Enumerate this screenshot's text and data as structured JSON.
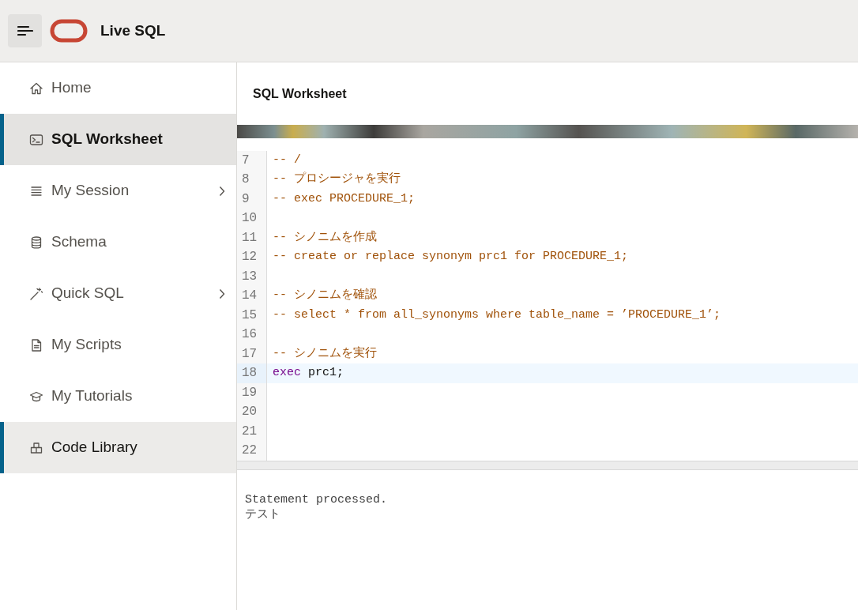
{
  "header": {
    "title": "Live SQL"
  },
  "sidebar": {
    "items": [
      {
        "label": "Home",
        "selected": false,
        "focused": false,
        "has_submenu": false
      },
      {
        "label": "SQL Worksheet",
        "selected": true,
        "focused": false,
        "has_submenu": false
      },
      {
        "label": "My Session",
        "selected": false,
        "focused": false,
        "has_submenu": true
      },
      {
        "label": "Schema",
        "selected": false,
        "focused": false,
        "has_submenu": false
      },
      {
        "label": "Quick SQL",
        "selected": false,
        "focused": false,
        "has_submenu": true
      },
      {
        "label": "My Scripts",
        "selected": false,
        "focused": false,
        "has_submenu": false
      },
      {
        "label": "My Tutorials",
        "selected": false,
        "focused": false,
        "has_submenu": false
      },
      {
        "label": "Code Library",
        "selected": false,
        "focused": true,
        "has_submenu": false
      }
    ]
  },
  "page": {
    "title": "SQL Worksheet"
  },
  "editor": {
    "lines": [
      {
        "number": "7",
        "active": false,
        "tokens": [
          {
            "kind": "comment",
            "text": "-- /"
          }
        ]
      },
      {
        "number": "8",
        "active": false,
        "tokens": [
          {
            "kind": "comment",
            "text": "-- プロシージャを実行"
          }
        ]
      },
      {
        "number": "9",
        "active": false,
        "tokens": [
          {
            "kind": "comment",
            "text": "-- exec PROCEDURE_1;"
          }
        ]
      },
      {
        "number": "10",
        "active": false
      },
      {
        "number": "11",
        "active": false,
        "tokens": [
          {
            "kind": "comment",
            "text": "-- シノニムを作成"
          }
        ]
      },
      {
        "number": "12",
        "active": false,
        "tokens": [
          {
            "kind": "comment",
            "text": "-- create or replace synonym prc1 for PROCEDURE_1;"
          }
        ]
      },
      {
        "number": "13",
        "active": false
      },
      {
        "number": "14",
        "active": false,
        "tokens": [
          {
            "kind": "comment",
            "text": "-- シノニムを確認"
          }
        ]
      },
      {
        "number": "15",
        "active": false,
        "tokens": [
          {
            "kind": "comment",
            "text": "-- select * from all_synonyms where table_name = ’PROCEDURE_1’;"
          }
        ]
      },
      {
        "number": "16",
        "active": false
      },
      {
        "number": "17",
        "active": false,
        "tokens": [
          {
            "kind": "comment",
            "text": "-- シノニムを実行"
          }
        ]
      },
      {
        "number": "18",
        "active": true,
        "tokens": [
          {
            "kind": "keyword",
            "text": "exec"
          },
          {
            "kind": "plain",
            "text": "prc1;"
          }
        ]
      },
      {
        "number": "19",
        "active": false
      },
      {
        "number": "20",
        "active": false
      },
      {
        "number": "21",
        "active": false
      },
      {
        "number": "22",
        "active": false
      }
    ]
  },
  "output": {
    "lines": [
      "Statement processed.",
      "テスト"
    ]
  }
}
